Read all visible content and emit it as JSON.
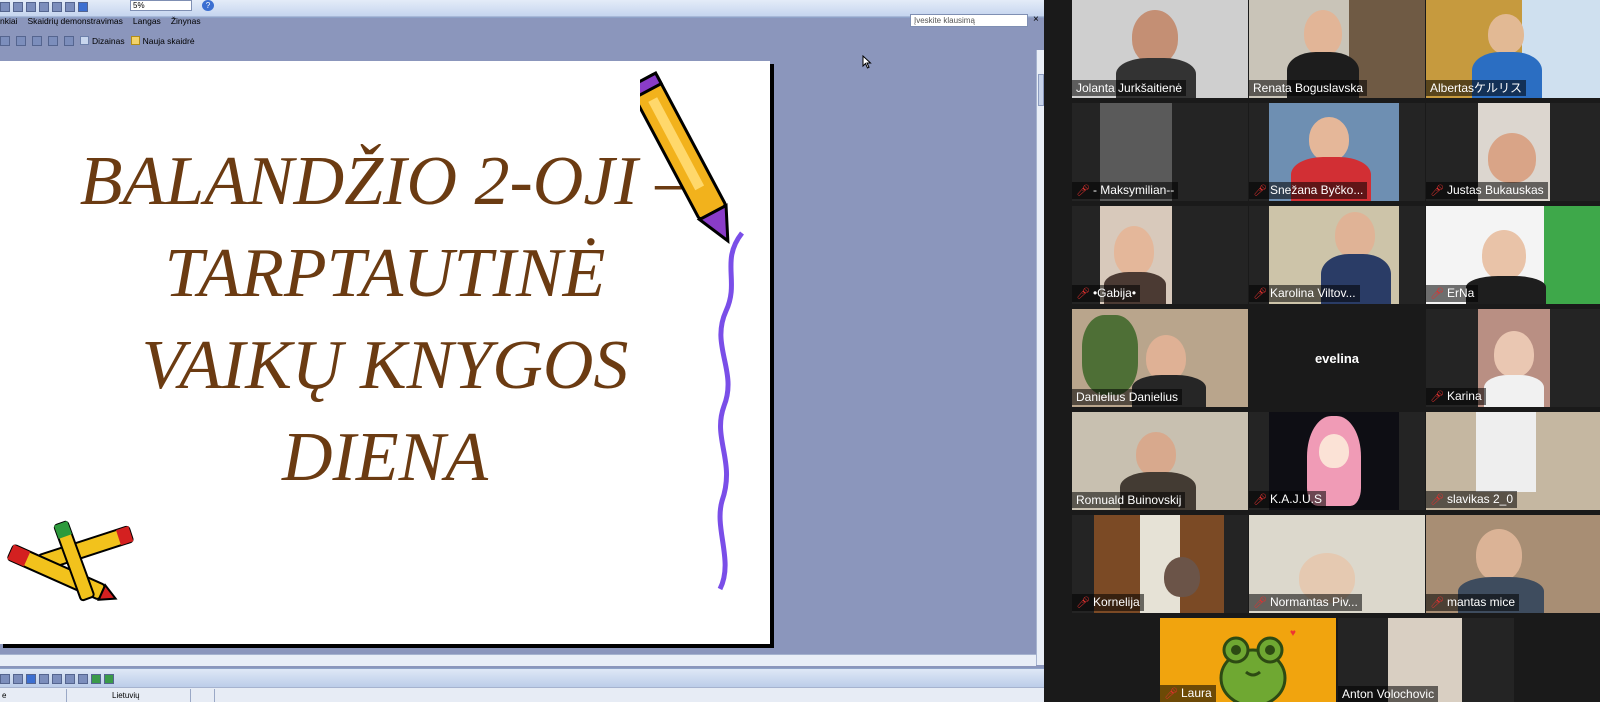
{
  "ppt": {
    "menu": [
      "nkiai",
      "Skaidrių demonstravimas",
      "Langas",
      "Žinynas"
    ],
    "zoom_value": "5%",
    "ask_placeholder": "Įveskite klausimą",
    "toolbar2": {
      "design_label": "Dizainas",
      "new_slide_label": "Nauja skaidrė"
    },
    "status": {
      "left_text": "e",
      "language": "Lietuvių"
    },
    "slide_title_lines": [
      "BALANDŽIO 2-OJI –",
      "TARPTAUTINĖ",
      "VAIKŲ KNYGOS",
      "DIENA"
    ],
    "title_color": "#6b3b12"
  },
  "gallery": {
    "participants": [
      {
        "name": "Jolanta Jurkšaitienė",
        "muted": false,
        "active": false
      },
      {
        "name": "Renata Boguslavska",
        "muted": false,
        "active": true
      },
      {
        "name": "Albertasケルリス",
        "muted": false,
        "active": false
      },
      {
        "name": "- Maksymilian--",
        "muted": true,
        "active": false
      },
      {
        "name": "Snežana Byčko...",
        "muted": true,
        "active": false
      },
      {
        "name": "Justas Bukauskas",
        "muted": true,
        "active": false
      },
      {
        "name": "•Gabija•",
        "muted": true,
        "active": false
      },
      {
        "name": "Karolina Viltov...",
        "muted": true,
        "active": false
      },
      {
        "name": "ErNa",
        "muted": true,
        "active": false
      },
      {
        "name": "Danielius Danielius",
        "muted": false,
        "active": false
      },
      {
        "name": "evelina",
        "muted": false,
        "active": false,
        "no_video": true
      },
      {
        "name": "Karina",
        "muted": true,
        "active": false
      },
      {
        "name": "Romuald Buinovskij",
        "muted": false,
        "active": false
      },
      {
        "name": "K.A.J.U.S",
        "muted": true,
        "active": false
      },
      {
        "name": "slavikas 2_0",
        "muted": true,
        "active": false
      },
      {
        "name": "Kornelija",
        "muted": true,
        "active": false
      },
      {
        "name": "Normantas Piv...",
        "muted": true,
        "active": false
      },
      {
        "name": "mantas mice",
        "muted": true,
        "active": false
      },
      {
        "name": "Laura",
        "muted": true,
        "active": false
      },
      {
        "name": "Anton Volochovic",
        "muted": false,
        "active": false
      }
    ]
  }
}
